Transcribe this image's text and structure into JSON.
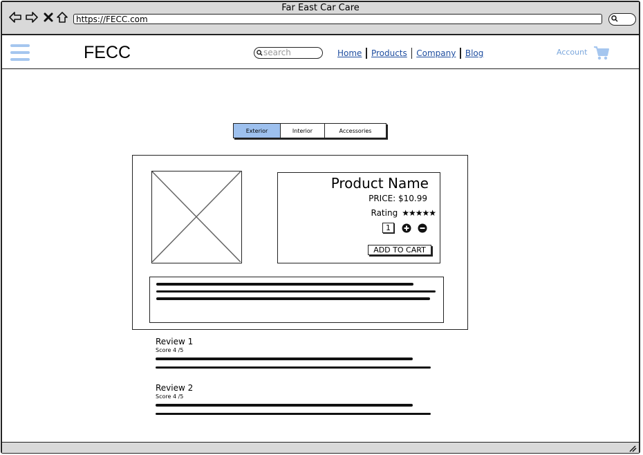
{
  "browser": {
    "window_title": "Far East Car Care",
    "url": "https://FECC.com"
  },
  "header": {
    "logo": "FECC",
    "search_placeholder": "search",
    "nav": [
      "Home",
      "Products",
      "Company",
      "Blog"
    ],
    "account": "Account"
  },
  "tabs": [
    {
      "label": "Exterior",
      "active": true
    },
    {
      "label": "Interior",
      "active": false
    },
    {
      "label": "Accessories",
      "active": false
    }
  ],
  "product": {
    "name": "Product Name",
    "price": "PRICE: $10.99",
    "rating_label": "Rating",
    "rating_stars": "★★★★★",
    "quantity": "1",
    "add_to_cart": "ADD TO CART"
  },
  "reviews": [
    {
      "title": "Review 1",
      "score": "Score 4 /5"
    },
    {
      "title": "Review 2",
      "score": "Score 4 /5"
    }
  ],
  "colors": {
    "accent": "#9dc0ee",
    "link": "#1f4ea0",
    "chrome": "#d9d9d9"
  }
}
